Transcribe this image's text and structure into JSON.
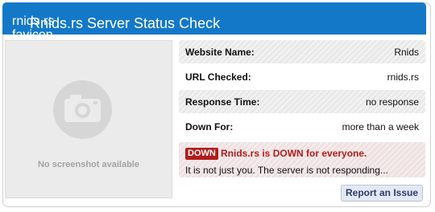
{
  "header": {
    "favicon_alt": "rnids.rs favicon",
    "title": "Rnids.rs Server Status Check"
  },
  "screenshot": {
    "placeholder_text": "No screenshot available",
    "icon": "camera-icon"
  },
  "details": [
    {
      "label": "Website Name:",
      "value": "Rnids"
    },
    {
      "label": "URL Checked:",
      "value": "rnids.rs"
    },
    {
      "label": "Response Time:",
      "value": "no response"
    },
    {
      "label": "Down For:",
      "value": "more than a week"
    }
  ],
  "status": {
    "badge": "DOWN",
    "headline": "Rnids.rs is DOWN for everyone.",
    "detail": "It is not just you. The server is not responding..."
  },
  "actions": {
    "report_label": "Report an Issue"
  },
  "colors": {
    "header_bg": "#1478c9",
    "down_red": "#b21c1c"
  }
}
